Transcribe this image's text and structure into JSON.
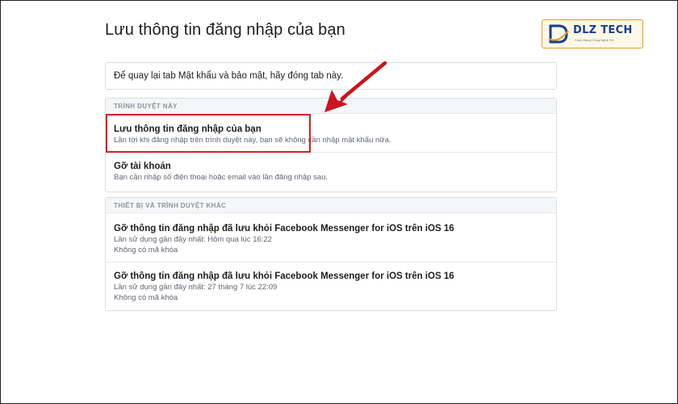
{
  "page": {
    "title": "Lưu thông tin đăng nhập của bạn"
  },
  "logo": {
    "text": "DLZ TECH",
    "tagline": "Cách Mạng Công Nghệ Số"
  },
  "info": {
    "text": "Để quay lại tab Mật khẩu và bảo mật, hãy đóng tab này."
  },
  "browser_section": {
    "header": "TRÌNH DUYỆT NÀY",
    "items": [
      {
        "title": "Lưu thông tin đăng nhập của bạn",
        "subtitle": "Lần tới khi đăng nhập trên trình duyệt này, bạn sẽ không cần nhập mật khẩu nữa."
      },
      {
        "title": "Gỡ tài khoản",
        "subtitle": "Bạn cần nhập số điện thoại hoặc email vào lần đăng nhập sau."
      }
    ]
  },
  "other_section": {
    "header": "THIẾT BỊ VÀ TRÌNH DUYỆT KHÁC",
    "items": [
      {
        "title": "Gỡ thông tin đăng nhập đã lưu khỏi Facebook Messenger for iOS trên iOS 16",
        "last_used": "Lần sử dụng gần đây nhất: Hôm qua lúc 16:22",
        "passcode": "Không có mã khóa"
      },
      {
        "title": "Gỡ thông tin đăng nhập đã lưu khỏi Facebook Messenger for iOS trên iOS 16",
        "last_used": "Lần sử dụng gần đây nhất: 27 tháng 7 lúc 22:09",
        "passcode": "Không có mã khóa"
      }
    ]
  },
  "colors": {
    "highlight": "#d52027",
    "arrow": "#c8161e",
    "logo_border": "#e0a020",
    "logo_text": "#1a3d8f"
  }
}
